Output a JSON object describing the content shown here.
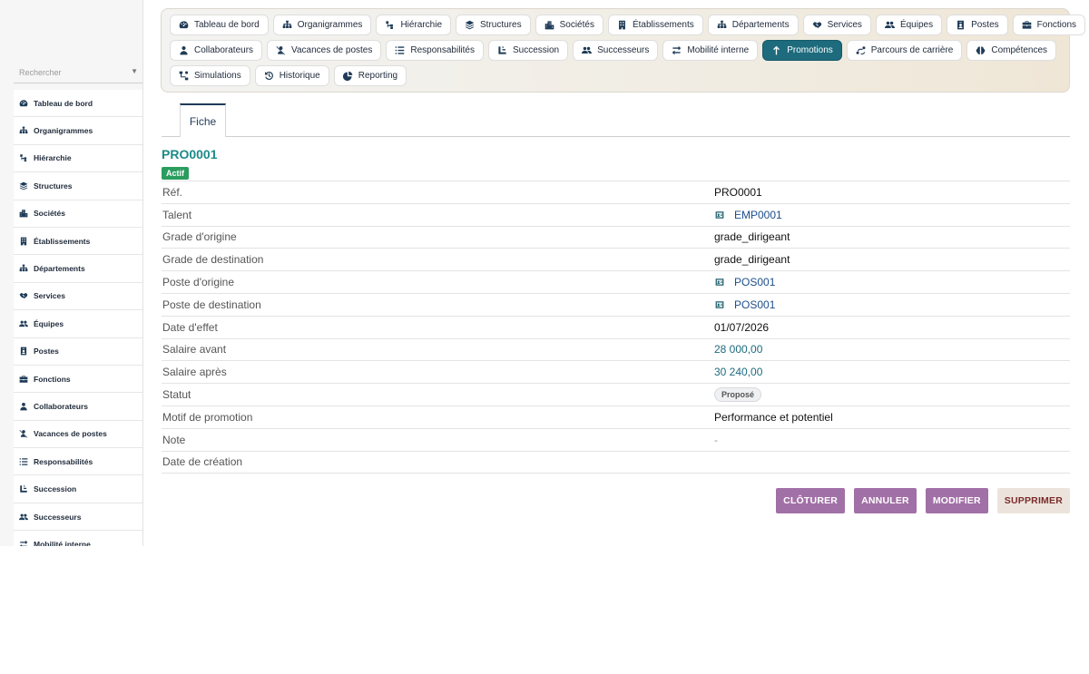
{
  "sidebar": {
    "search_placeholder": "Rechercher",
    "items": [
      {
        "label": "Tableau de bord",
        "icon": "dashboard-icon"
      },
      {
        "label": "Organigrammes",
        "icon": "sitemap-icon"
      },
      {
        "label": "Hiérarchie",
        "icon": "hierarchy-icon"
      },
      {
        "label": "Structures",
        "icon": "layers-icon"
      },
      {
        "label": "Sociétés",
        "icon": "city-icon"
      },
      {
        "label": "Établissements",
        "icon": "building-icon"
      },
      {
        "label": "Départements",
        "icon": "sitemap-icon"
      },
      {
        "label": "Services",
        "icon": "handshake-icon"
      },
      {
        "label": "Équipes",
        "icon": "users-icon"
      },
      {
        "label": "Postes",
        "icon": "badge-icon"
      },
      {
        "label": "Fonctions",
        "icon": "briefcase-icon"
      },
      {
        "label": "Collaborateurs",
        "icon": "user-icon"
      },
      {
        "label": "Vacances de postes",
        "icon": "user-slash-icon"
      },
      {
        "label": "Responsabilités",
        "icon": "list-icon"
      },
      {
        "label": "Succession",
        "icon": "succession-icon"
      },
      {
        "label": "Successeurs",
        "icon": "users-icon"
      },
      {
        "label": "Mobilité interne",
        "icon": "arrows-icon"
      }
    ]
  },
  "topnav": {
    "rows": [
      [
        {
          "label": "Tableau de bord",
          "icon": "dashboard-icon"
        },
        {
          "label": "Organigrammes",
          "icon": "sitemap-icon"
        },
        {
          "label": "Hiérarchie",
          "icon": "hierarchy-icon"
        },
        {
          "label": "Structures",
          "icon": "layers-icon"
        },
        {
          "label": "Sociétés",
          "icon": "city-icon"
        },
        {
          "label": "Établissements",
          "icon": "building-icon"
        },
        {
          "label": "Départements",
          "icon": "sitemap-icon"
        },
        {
          "label": "Services",
          "icon": "handshake-icon"
        },
        {
          "label": "Équipes",
          "icon": "users-icon"
        },
        {
          "label": "Postes",
          "icon": "badge-icon"
        },
        {
          "label": "Fonctions",
          "icon": "briefcase-icon"
        }
      ],
      [
        {
          "label": "Collaborateurs",
          "icon": "user-icon"
        },
        {
          "label": "Vacances de postes",
          "icon": "user-slash-icon"
        },
        {
          "label": "Responsabilités",
          "icon": "list-icon"
        },
        {
          "label": "Succession",
          "icon": "succession-icon"
        },
        {
          "label": "Successeurs",
          "icon": "users-icon"
        },
        {
          "label": "Mobilité interne",
          "icon": "arrows-icon"
        },
        {
          "label": "Promotions",
          "icon": "arrow-up-icon",
          "active": true
        },
        {
          "label": "Parcours de carrière",
          "icon": "route-icon"
        },
        {
          "label": "Compétences",
          "icon": "brain-icon"
        }
      ],
      [
        {
          "label": "Simulations",
          "icon": "diagram-icon"
        },
        {
          "label": "Historique",
          "icon": "history-icon"
        },
        {
          "label": "Reporting",
          "icon": "pie-icon"
        }
      ]
    ]
  },
  "tabs": {
    "fiche": "Fiche"
  },
  "record": {
    "id": "PRO0001",
    "status_badge": "Actif",
    "fields": [
      {
        "label": "Réf.",
        "value": "PRO0001",
        "kind": "text"
      },
      {
        "label": "Talent",
        "value": "EMP0001",
        "kind": "link"
      },
      {
        "label": "Grade d'origine",
        "value": "grade_dirigeant",
        "kind": "text"
      },
      {
        "label": "Grade de destination",
        "value": "grade_dirigeant",
        "kind": "text"
      },
      {
        "label": "Poste d'origine",
        "value": "POS001",
        "kind": "link"
      },
      {
        "label": "Poste de destination",
        "value": "POS001",
        "kind": "link"
      },
      {
        "label": "Date d'effet",
        "value": "01/07/2026",
        "kind": "text"
      },
      {
        "label": "Salaire avant",
        "value": "28 000,00",
        "kind": "money"
      },
      {
        "label": "Salaire après",
        "value": "30 240,00",
        "kind": "money"
      },
      {
        "label": "Statut",
        "value": "Proposé",
        "kind": "pill"
      },
      {
        "label": "Motif de promotion",
        "value": "Performance et potentiel",
        "kind": "text"
      },
      {
        "label": "Note",
        "value": "-",
        "kind": "dash"
      },
      {
        "label": "Date de création",
        "value": "",
        "kind": "text"
      }
    ]
  },
  "actions": {
    "cloturer": "CLÔTURER",
    "annuler": "ANNULER",
    "modifier": "MODIFIER",
    "supprimer": "SUPPRIMER"
  },
  "colors": {
    "active_nav": "#1d6b7d",
    "record_id": "#1d8a88",
    "badge_actif": "#2a9d5e",
    "action_primary": "#a170a6",
    "action_danger_bg": "#ece4dc"
  }
}
